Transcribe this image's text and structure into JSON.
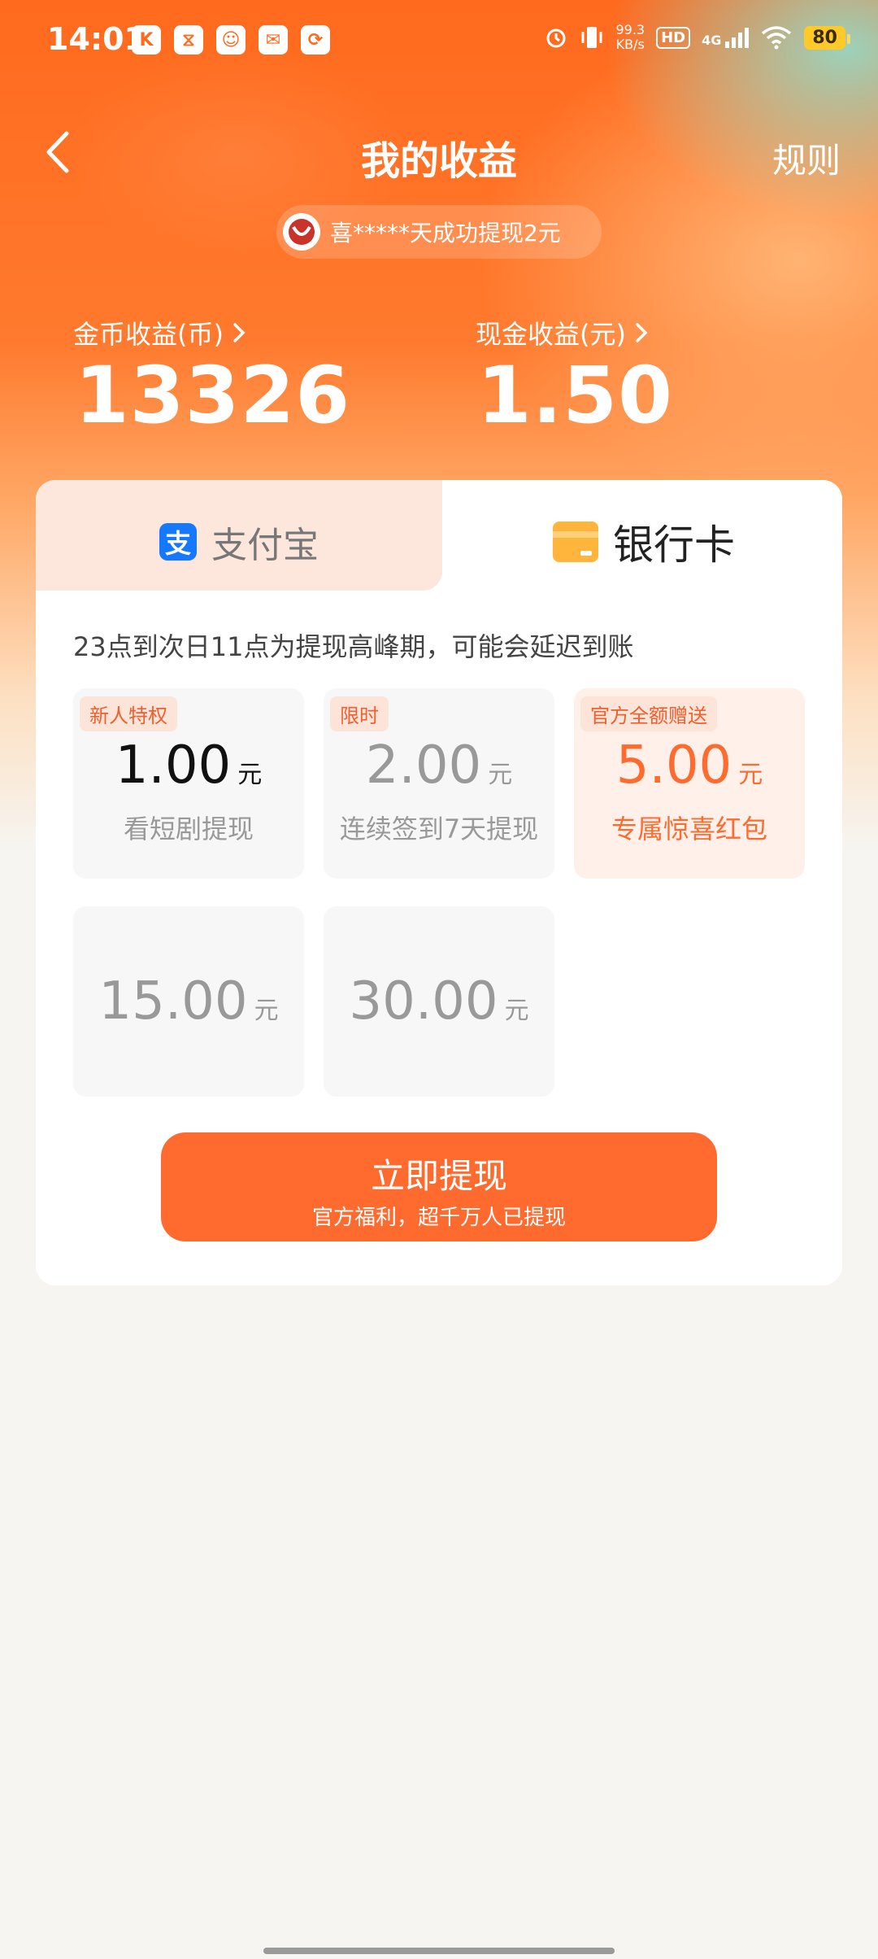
{
  "status_bar": {
    "time": "14:01",
    "app_icons": [
      "K",
      "⧖",
      "☺",
      "✉",
      "⟳"
    ],
    "net_speed_value": "99.3",
    "net_speed_unit": "KB/s",
    "hd": "HD",
    "network": "4G",
    "battery": "80"
  },
  "header": {
    "title": "我的收益",
    "rules": "规则"
  },
  "ticker": {
    "text": "喜*****天成功提现2元"
  },
  "earnings": {
    "coins_label": "金币收益(币)",
    "coins_value": "13326",
    "cash_label": "现金收益(元)",
    "cash_value": "1.50"
  },
  "tabs": {
    "alipay": "支付宝",
    "alipay_icon_glyph": "支",
    "bank": "银行卡"
  },
  "notice": "23点到次日11点为提现高峰期，可能会延迟到账",
  "options": [
    {
      "tag": "新人特权",
      "amount": "1.00",
      "unit": "元",
      "desc": "看短剧提现"
    },
    {
      "tag": "限时",
      "amount": "2.00",
      "unit": "元",
      "desc": "连续签到7天提现"
    },
    {
      "tag": "官方全额赠送",
      "amount": "5.00",
      "unit": "元",
      "desc": "专属惊喜红包"
    },
    {
      "amount": "15.00",
      "unit": "元"
    },
    {
      "amount": "30.00",
      "unit": "元"
    }
  ],
  "cta": {
    "label": "立即提现",
    "sub": "官方福利，超千万人已提现"
  },
  "colors": {
    "primary": "#ff6a2e",
    "alipay_blue": "#1677ff",
    "bank_yellow": "#ffb53b"
  }
}
